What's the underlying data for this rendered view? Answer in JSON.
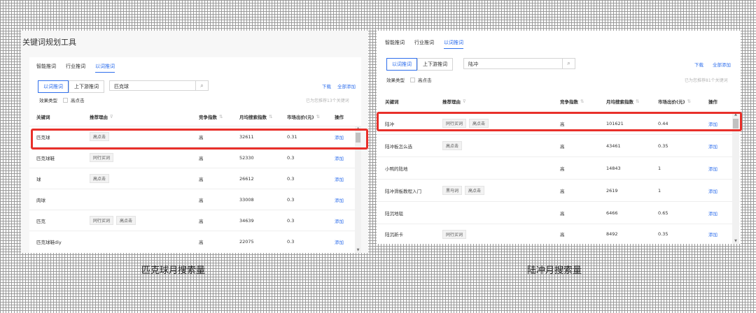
{
  "left": {
    "tool_title": "关键词规划工具",
    "tabs": [
      "智能推词",
      "行业推词",
      "以词推词"
    ],
    "active_tab": 2,
    "seg": [
      "以词推词",
      "上下游推词"
    ],
    "search_value": "匹克球",
    "effect_label": "效果类型",
    "effect_option": "高点击",
    "download": "下载",
    "add_all": "全部添加",
    "note": "已为您推荐13个关键词",
    "headers": {
      "keyword": "关键词",
      "reason": "推荐理由",
      "competition": "竞争指数",
      "monthly": "月均搜索指数",
      "bid": "市场出价(元)",
      "action": "操作"
    },
    "rows": [
      {
        "keyword": "匹克球",
        "tags": [
          "高点击"
        ],
        "competition": "高",
        "monthly": "32611",
        "bid": "0.31",
        "action": "添加"
      },
      {
        "keyword": "匹克球鞋",
        "tags": [
          "同行买词"
        ],
        "competition": "高",
        "monthly": "52330",
        "bid": "0.3",
        "action": "添加"
      },
      {
        "keyword": "球",
        "tags": [
          "高点击"
        ],
        "competition": "高",
        "monthly": "26612",
        "bid": "0.3",
        "action": "添加"
      },
      {
        "keyword": "肉球",
        "tags": [],
        "competition": "高",
        "monthly": "33008",
        "bid": "0.3",
        "action": "添加"
      },
      {
        "keyword": "匹克",
        "tags": [
          "同行买词",
          "高点击"
        ],
        "competition": "高",
        "monthly": "34639",
        "bid": "0.3",
        "action": "添加"
      },
      {
        "keyword": "匹克球鞋diy",
        "tags": [],
        "competition": "高",
        "monthly": "22075",
        "bid": "0.3",
        "action": "添加"
      }
    ],
    "caption": "匹克球月搜索量"
  },
  "right": {
    "tabs": [
      "智能推词",
      "行业推词",
      "以词推词"
    ],
    "active_tab": 2,
    "seg": [
      "以词推词",
      "上下游推词"
    ],
    "search_value": "陆冲",
    "effect_label": "效果类型",
    "effect_option": "高点击",
    "download": "下载",
    "add_all": "全部添加",
    "note": "已为您推荐81个关键词",
    "headers": {
      "keyword": "关键词",
      "reason": "推荐理由",
      "competition": "竞争指数",
      "monthly": "月均搜索指数",
      "bid": "市场出价(元)",
      "action": "操作"
    },
    "rows": [
      {
        "keyword": "陆冲",
        "tags": [
          "同行买词",
          "高点击"
        ],
        "competition": "高",
        "monthly": "101621",
        "bid": "0.44",
        "action": "添加"
      },
      {
        "keyword": "陆冲板怎么选",
        "tags": [
          "高点击"
        ],
        "competition": "高",
        "monthly": "43461",
        "bid": "0.35",
        "action": "添加"
      },
      {
        "keyword": "小鸭的陆地",
        "tags": [],
        "competition": "高",
        "monthly": "14843",
        "bid": "1",
        "action": "添加"
      },
      {
        "keyword": "陆冲滑板教程入门",
        "tags": [
          "黑马词",
          "高点击"
        ],
        "competition": "高",
        "monthly": "2619",
        "bid": "1",
        "action": "添加"
      },
      {
        "keyword": "陆沉地毯",
        "tags": [],
        "competition": "高",
        "monthly": "6466",
        "bid": "0.65",
        "action": "添加"
      },
      {
        "keyword": "陆沉新卡",
        "tags": [
          "同行买词"
        ],
        "competition": "高",
        "monthly": "8492",
        "bid": "0.35",
        "action": "添加"
      }
    ],
    "caption": "陆冲月搜索量"
  },
  "colors": {
    "accent": "#2f6fec",
    "highlight": "#e8302a"
  },
  "icons": {
    "search": "search-icon",
    "sort": "sort-icon",
    "filter": "filter-icon"
  }
}
